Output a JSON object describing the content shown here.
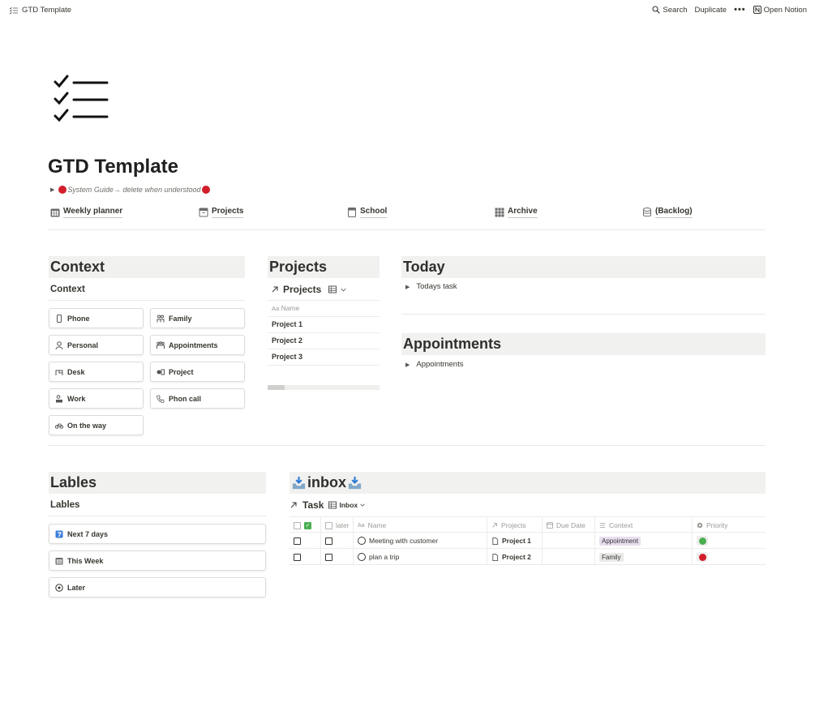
{
  "topbar": {
    "breadcrumb_icon": "checklist-icon",
    "breadcrumb": "GTD Template",
    "search": "Search",
    "duplicate": "Duplicate",
    "more": "•••",
    "open_notion": "Open Notion"
  },
  "page": {
    "icon": "checklist-icon",
    "title": "GTD Template",
    "guide_toggle": "System Guide→ delete when understood"
  },
  "links": [
    {
      "label": "Weekly planner",
      "icon": "calendar-icon"
    },
    {
      "label": "Projects",
      "icon": "archive-box-icon"
    },
    {
      "label": "School",
      "icon": "notebook-icon"
    },
    {
      "label": "Archive",
      "icon": "archive-grid-icon"
    },
    {
      "label": "(Backlog)",
      "icon": "database-icon"
    }
  ],
  "context": {
    "header": "Context",
    "subtitle": "Context",
    "cards": [
      {
        "label": "Phone",
        "icon": "phone-icon"
      },
      {
        "label": "Family",
        "icon": "family-icon"
      },
      {
        "label": "Personal",
        "icon": "person-icon"
      },
      {
        "label": "Appointments",
        "icon": "group-icon"
      },
      {
        "label": "Desk",
        "icon": "desk-icon"
      },
      {
        "label": "Project",
        "icon": "project-icon"
      },
      {
        "label": "Work",
        "icon": "work-icon"
      },
      {
        "label": "Phon call",
        "icon": "phone-call-icon"
      },
      {
        "label": "On the way",
        "icon": "bicycle-icon"
      }
    ]
  },
  "projects": {
    "header": "Projects",
    "subtitle": "Projects",
    "col_name": "Name",
    "rows": [
      "Project 1",
      "Project 2",
      "Project 3"
    ]
  },
  "today": {
    "header": "Today",
    "toggle": "Todays task"
  },
  "appointments": {
    "header": "Appointments",
    "toggle": "Appointments"
  },
  "lables": {
    "header": "Lables",
    "subtitle": "Lables",
    "cards": [
      {
        "label": "Next 7 days",
        "icon": "seven-icon"
      },
      {
        "label": "This Week",
        "icon": "calendar-icon"
      },
      {
        "label": "Later",
        "icon": "clock-icon"
      }
    ]
  },
  "inbox": {
    "header": "inbox",
    "header_icon": "inbox-tray-icon",
    "table_title": "Task",
    "view": "Inbox",
    "columns": {
      "later": "later",
      "name": "Name",
      "projects": "Projects",
      "due": "Due Date",
      "context": "Context",
      "priority": "Priority"
    },
    "rows": [
      {
        "name": "Meeting with customer",
        "project": "Project 1",
        "context": "Appointment",
        "priority_color": "#4caf50"
      },
      {
        "name": "plan a trip",
        "project": "Project 2",
        "context": "Family",
        "priority_color": "#d21e2b"
      }
    ]
  }
}
